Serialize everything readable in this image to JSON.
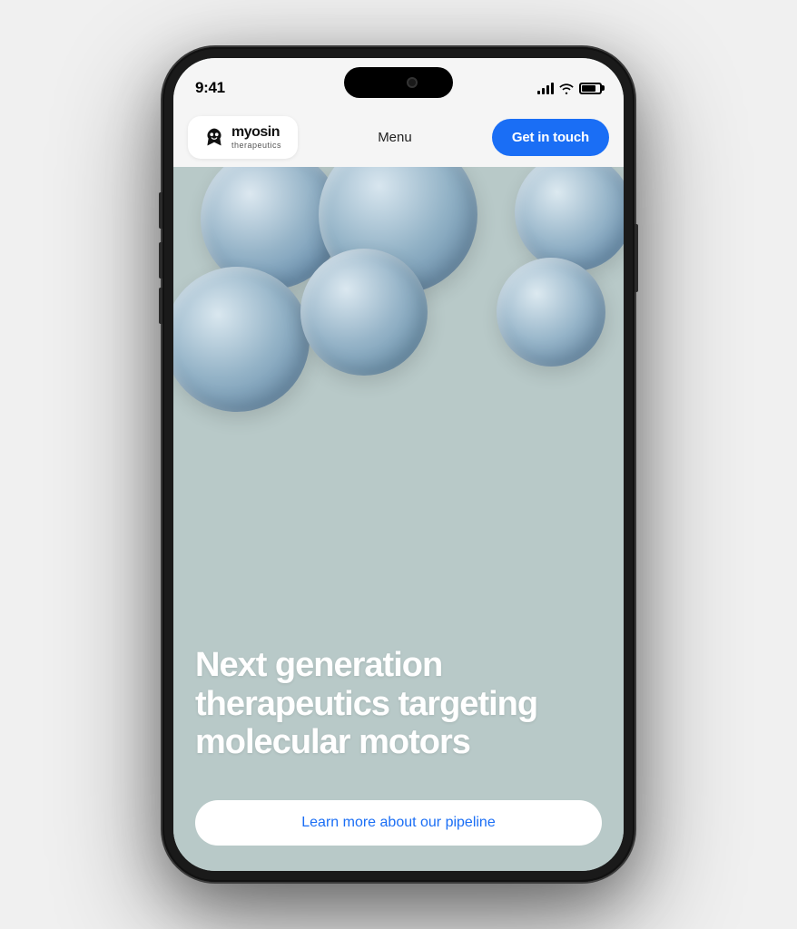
{
  "phone": {
    "statusBar": {
      "time": "9:41",
      "signalBars": 4,
      "wifiOn": true,
      "batteryLevel": 80
    },
    "nav": {
      "logoName": "myosin",
      "logoSub": "therapeutics",
      "menuLabel": "Menu",
      "ctaLabel": "Get in touch"
    },
    "hero": {
      "headline": "Next generation therapeutics targeting molecular motors",
      "ctaLabel": "Learn more about our pipeline"
    }
  },
  "colors": {
    "ctaBlue": "#1a6ef5",
    "heroBg": "#b8c9c8",
    "navBg": "#f5f5f5"
  }
}
